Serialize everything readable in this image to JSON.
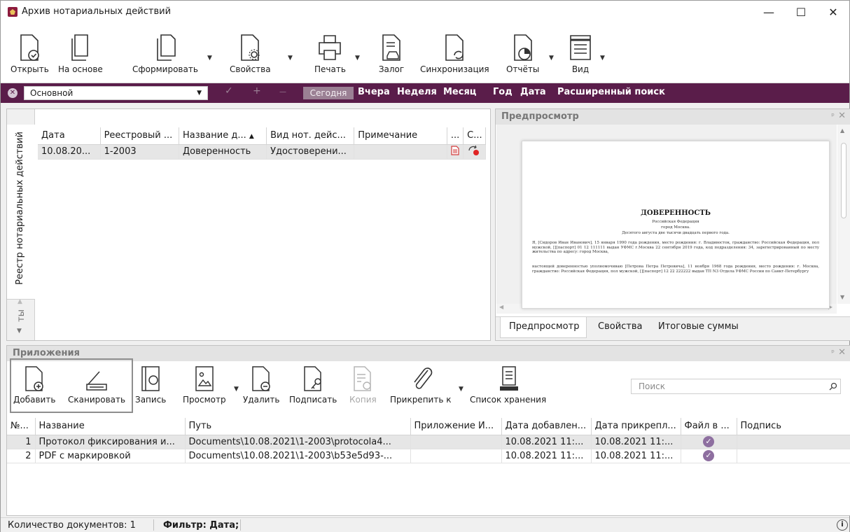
{
  "window": {
    "title": "Архив нотариальных действий",
    "minimize": "—",
    "maximize": "☐",
    "close": "✕"
  },
  "ribbon": {
    "open": "Открыть",
    "based_on": "На основе",
    "form": "Сформировать",
    "properties": "Свойства",
    "print": "Печать",
    "pledge": "Залог",
    "sync": "Синхронизация",
    "reports": "Отчёты",
    "view": "Вид"
  },
  "filterbar": {
    "combo_value": "Основной",
    "check": "✓",
    "plus": "+",
    "minus": "—",
    "today": "Сегодня",
    "yesterday": "Вчера",
    "week": "Неделя",
    "month": "Месяц",
    "year": "Год",
    "date": "Дата",
    "advanced": "Расширенный поиск"
  },
  "registry": {
    "side_tab": "Реестр нотариальных действий",
    "side_tab2": "ты",
    "columns": [
      "Дата",
      "Реестровый ...",
      "Название д...",
      "Вид нот. дейс...",
      "Примечание",
      "...",
      "С..."
    ],
    "sort_marker": "▲",
    "rows": [
      {
        "date": "10.08.20...",
        "reg": "1-2003",
        "name": "Доверенность",
        "kind": "Удостоверени...",
        "note": ""
      }
    ]
  },
  "preview": {
    "title": "Предпросмотр",
    "pin": "ᵖ",
    "close": "✕",
    "tabs": [
      "Предпросмотр",
      "Свойства",
      "Итоговые суммы"
    ],
    "doc": {
      "heading": "ДОВЕРЕННОСТЬ",
      "line1": "Российская Федерация",
      "line2": "город Москва.",
      "line3": "Десятого августа две тысячи двадцать первого года.",
      "para1": "Я, [Сидоров Иван Иванович], 15 января 1990 года рождения, место рождения: г. Владивосток, гражданство: Российская Федерация, пол мужской, [][паспорт] 01 12 111111 выдан УФМС г.Москва 22 сентября 2019 года, код подразделения: 34, зарегистрированный по месту жительства по адресу: город Москва,",
      "para2": "настоящей доверенностью уполномочиваю [Петрова Петра Петровича], 11 ноября 1968 года рождения, место рождения: г. Москва, гражданство: Российская Федерация, пол мужской, [][паспорт] 12 22 222222 выдан ТП N3 Отдела УФМС России по Санкт-Петербургу"
    }
  },
  "attachments": {
    "title": "Приложения",
    "add": "Добавить",
    "scan": "Сканировать",
    "record": "Запись",
    "view": "Просмотр",
    "delete": "Удалить",
    "sign": "Подписать",
    "copy": "Копия",
    "attach": "Прикрепить к",
    "storage": "Список хранения",
    "search_placeholder": "Поиск",
    "columns": [
      "№...",
      "Название",
      "Путь",
      "Приложение И...",
      "Дата добавлен...",
      "Дата прикрепл...",
      "Файл в ...",
      "Подпись"
    ],
    "rows": [
      {
        "num": "1",
        "name": "Протокол фиксирования и...",
        "path": "Documents\\10.08.2021\\1-2003\\protocola4...",
        "app": "",
        "added": "10.08.2021 11:...",
        "attached": "10.08.2021 11:...",
        "sign": ""
      },
      {
        "num": "2",
        "name": "PDF с маркировкой",
        "path": "Documents\\10.08.2021\\1-2003\\b53e5d93-...",
        "app": "",
        "added": "10.08.2021 11:...",
        "attached": "10.08.2021 11:...",
        "sign": ""
      }
    ]
  },
  "status": {
    "count": "Количество документов: 1",
    "filter": "Фильтр: Дата;",
    "info": "i"
  }
}
